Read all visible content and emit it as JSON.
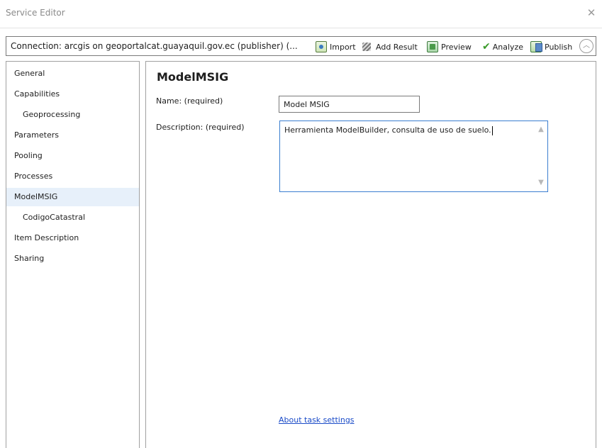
{
  "window": {
    "title": "Service Editor",
    "close_glyph": "✕"
  },
  "toolbar": {
    "connection": "Connection: arcgis on geoportalcat.guayaquil.gov.ec (publisher) (...",
    "import_label": "Import",
    "add_result_label": "Add Result",
    "preview_label": "Preview",
    "analyze_label": "Analyze",
    "publish_label": "Publish",
    "collapse_glyph": "︿"
  },
  "sidebar": {
    "items": [
      {
        "label": "General"
      },
      {
        "label": "Capabilities"
      },
      {
        "label": "Geoprocessing"
      },
      {
        "label": "Parameters"
      },
      {
        "label": "Pooling"
      },
      {
        "label": "Processes"
      },
      {
        "label": "ModelMSIG"
      },
      {
        "label": "CodigoCatastral"
      },
      {
        "label": "Item Description"
      },
      {
        "label": "Sharing"
      }
    ],
    "selected": "ModelMSIG"
  },
  "main": {
    "title": "ModelMSIG",
    "name_label": "Name:  (required)",
    "name_value": "Model MSIG",
    "description_label": "Description:  (required)",
    "description_value": "Herramienta ModelBuilder, consulta de uso de suelo.",
    "about_link": "About task settings"
  },
  "colors": {
    "selection": "#e7f0fa",
    "link": "#1a4bc8",
    "focus_border": "#3b7ed0",
    "analyze_check": "#3a9a2a"
  },
  "icons": [
    "import-icon",
    "add-result-icon",
    "preview-icon",
    "checkmark-icon",
    "publish-icon",
    "chevron-up-icon",
    "close-icon"
  ]
}
